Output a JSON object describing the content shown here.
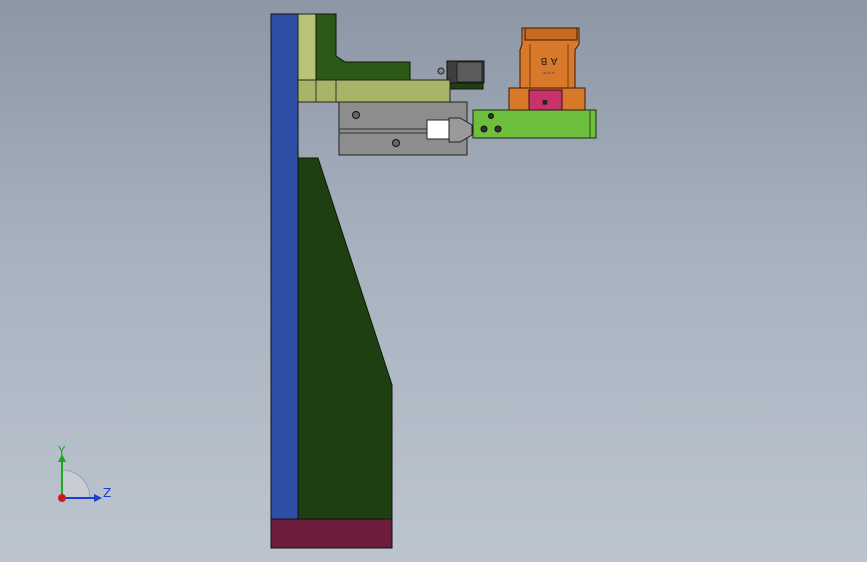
{
  "model_view": {
    "part_labels": {
      "connector_top": "A  B",
      "connector_small": "~~~",
      "connector_pink": "■"
    }
  },
  "triad": {
    "y_label": "Y",
    "z_label": "Z"
  },
  "colors": {
    "background_top": "#8c96a4",
    "background_bottom": "#bcc5cf",
    "column_blue": "#2f4fa6",
    "column_olive": "#b8c27a",
    "base_maroon": "#6e1d3c",
    "body_dark_green": "#1d3f12",
    "arm_olive": "#a9b466",
    "cylinder_gray": "#8d8d8d",
    "gripper_green": "#6fbf3e",
    "connector_orange": "#d8782a",
    "connector_pink": "#c8336b",
    "axis_blue": "#1a3fd0",
    "axis_green": "#1fa81f",
    "axis_red": "#d01a1a"
  }
}
